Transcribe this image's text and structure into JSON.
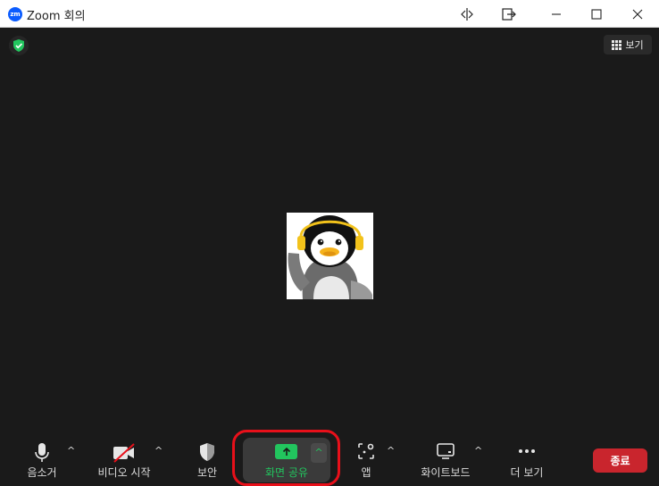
{
  "titlebar": {
    "logo_text": "zm",
    "title": "Zoom 회의"
  },
  "meeting": {
    "view_label": "보기",
    "avatar": "penguin-profile-image"
  },
  "toolbar": {
    "mute_label": "음소거",
    "video_label": "비디오 시작",
    "security_label": "보안",
    "share_label": "화면 공유",
    "apps_label": "앱",
    "whiteboard_label": "화이트보드",
    "more_label": "더 보기",
    "end_label": "종료",
    "caret": "^"
  },
  "colors": {
    "share_accent": "#22c55e",
    "end_button": "#c9252d",
    "highlight_ring": "#e8101a",
    "zoom_blue": "#0b5cff"
  }
}
